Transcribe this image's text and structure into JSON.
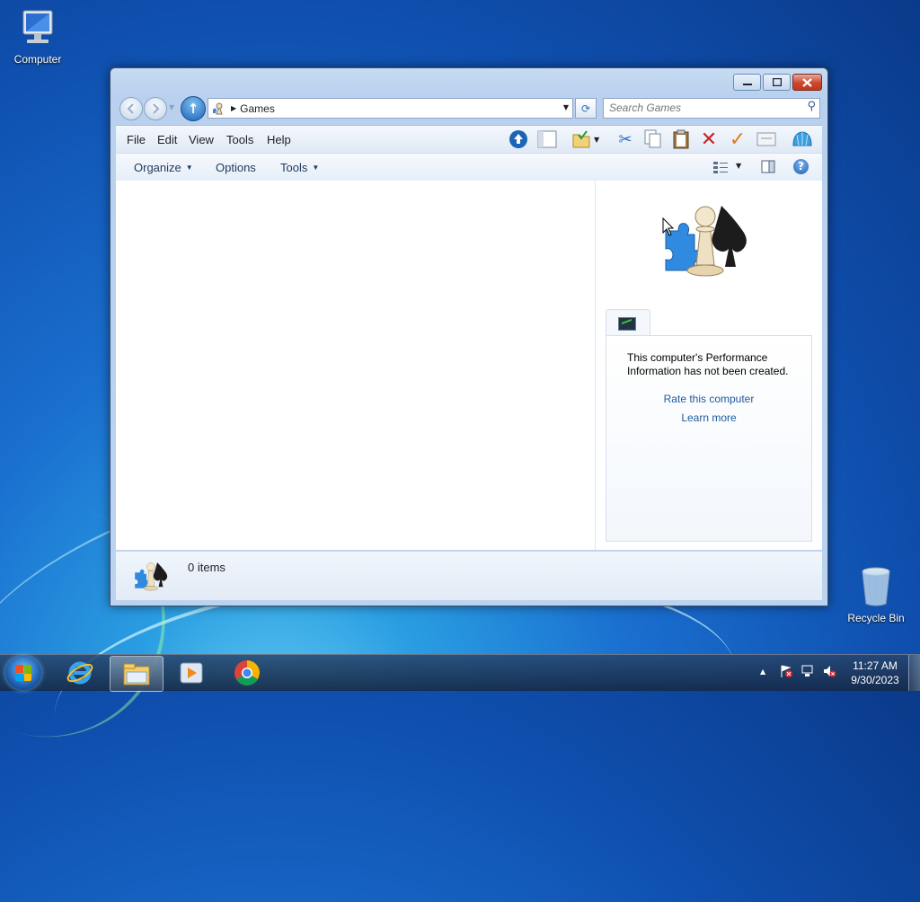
{
  "desktop": {
    "icons": [
      {
        "label": "Computer"
      },
      {
        "label": "Recycle Bin"
      }
    ]
  },
  "window": {
    "address": {
      "location": "Games"
    },
    "search": {
      "placeholder": "Search Games"
    },
    "menu": [
      "File",
      "Edit",
      "View",
      "Tools",
      "Help"
    ],
    "commands": {
      "organize": "Organize",
      "options": "Options",
      "tools": "Tools"
    },
    "preview": {
      "message": "This computer's Performance Information has not been created.",
      "rate_link": "Rate this computer",
      "learn_link": "Learn more"
    },
    "status": {
      "count": "0 items"
    }
  },
  "taskbar": {
    "time": "11:27 AM",
    "date": "9/30/2023"
  },
  "colors": {
    "link": "#1d5a9e",
    "accent": "#1b64b8",
    "desktop": "#1a6fcf"
  }
}
